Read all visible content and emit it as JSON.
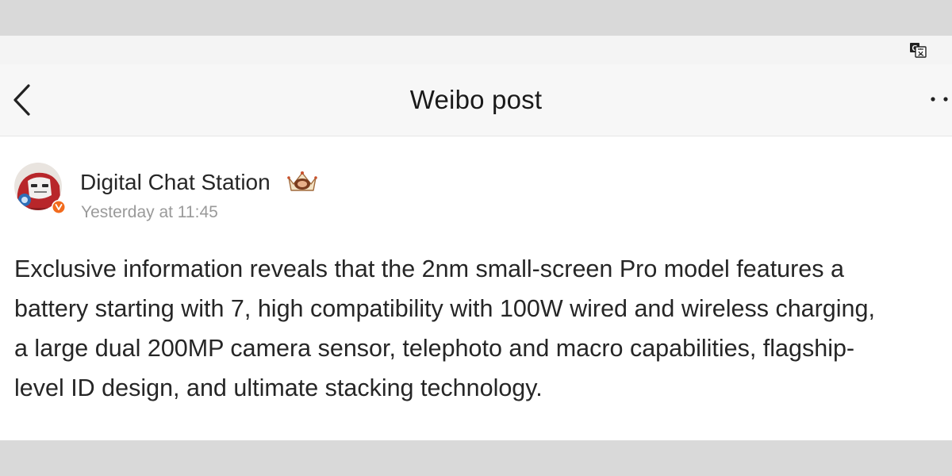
{
  "nav": {
    "title": "Weibo post"
  },
  "icons": {
    "translate": "translate-icon",
    "back": "chevron-left-icon",
    "more": "more-dots-icon",
    "verified": "verified-v-badge-icon",
    "user_badge": "crown-badge-icon"
  },
  "post": {
    "author": "Digital Chat Station",
    "time": "Yesterday at 11:45",
    "text_lines": [
      "Exclusive information reveals that the 2nm small-screen Pro model features a",
      "battery starting with 7, high compatibility with 100W wired and wireless charging,",
      "a large dual 200MP camera sensor, telephoto and macro capabilities, flagship-",
      "level ID design, and ultimate stacking technology."
    ]
  },
  "colors": {
    "verified_badge": "#f26b1d",
    "secondary_text": "#9a9a9a",
    "primary_text": "#262626"
  }
}
